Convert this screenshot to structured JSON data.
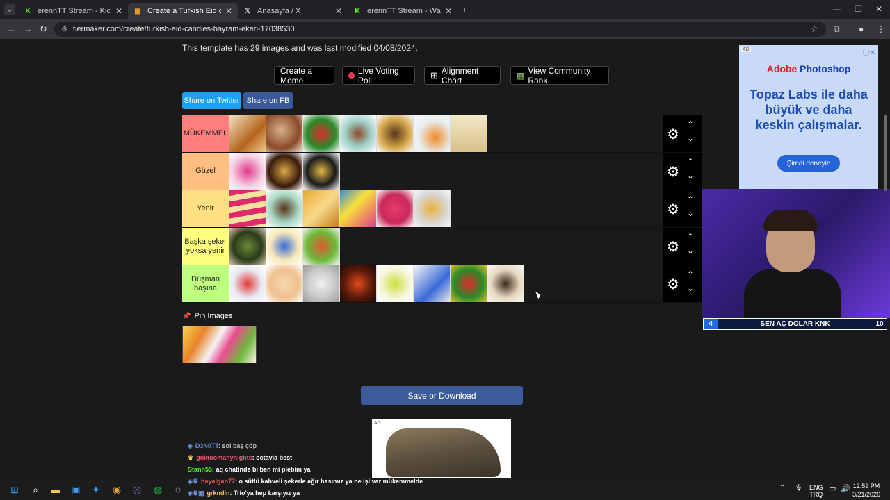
{
  "browser": {
    "tabs": [
      {
        "label": "erennTT Stream - Kick Dashboa",
        "icon": "kick-icon",
        "color": "#53fc18"
      },
      {
        "label": "Create a Turkish Eid candies (Ba",
        "icon": "tiermaker-icon",
        "color": "#f5a623"
      },
      {
        "label": "Anasayfa / X",
        "icon": "x-icon",
        "color": "#ffffff"
      },
      {
        "label": "erennTT Stream - Watch Live o",
        "icon": "kick-icon",
        "color": "#53fc18"
      }
    ],
    "url": "tiermaker.com/create/turkish-eid-candies-bayram-ekeri-17038530"
  },
  "page": {
    "template_info": "This template has 29 images and was last modified 04/08/2024.",
    "buttons": {
      "create_meme": "Create a Meme",
      "live_voting": "Live Voting Poll",
      "alignment_chart": "Alignment Chart",
      "community_rank": "View Community Rank"
    },
    "share": {
      "twitter": "Share on Twitter",
      "fb": "Share on FB",
      "twitter_color": "#1da1f2",
      "fb_color": "#3b5998"
    },
    "tiers": [
      {
        "label": "MÜKEMMEL",
        "color": "#ff7f7f",
        "count": 7
      },
      {
        "label": "Güzel",
        "color": "#ffbf7f",
        "count": 3
      },
      {
        "label": "Yenir",
        "color": "#ffdf7f",
        "count": 6
      },
      {
        "label": "Başka şeker yoksa yenir",
        "color": "#ffff7f",
        "count": 3
      },
      {
        "label": "Düşman başına",
        "color": "#bfff7f",
        "count": 8
      }
    ],
    "pin_images": "Pin Images",
    "save_button": "Save or Download"
  },
  "ad_right": {
    "ad_tag": "AD",
    "brand_a": "Adobe ",
    "brand_b": "Photoshop",
    "headline": "Topaz Labs ile daha büyük ve daha keskin çalışmalar.",
    "cta": "Şimdi deneyin"
  },
  "ad_bottom": {
    "ad_tag": "AD"
  },
  "stream_bar": {
    "left": "4",
    "text": "SEN AÇ DOLAR KNK",
    "right": "10"
  },
  "chat": [
    {
      "user": "D3N0TT",
      "msg": ": sol baş çöp",
      "color": "#6a8fd8"
    },
    {
      "user": "goktoomanynights",
      "msg": ": octavia best",
      "color": "#e8557a"
    },
    {
      "user": "Stann55",
      "msg": ": aq chatinde bi ben mi plebim ya",
      "color": "#53fc18"
    },
    {
      "user": "hayalgan77",
      "msg": ": o sütlü kahveli şekerle ağır hasımız ya ne işi var mükemmelde",
      "color": "#e85a5a"
    },
    {
      "user": "grkndln",
      "msg": ": Trio'ya hep karşıyız ya",
      "color": "#f7c948"
    }
  ],
  "taskbar": {
    "lang_top": "ENG",
    "lang_bottom": "TRQ",
    "time": "12:59 PM",
    "date": "3/21/2026"
  }
}
